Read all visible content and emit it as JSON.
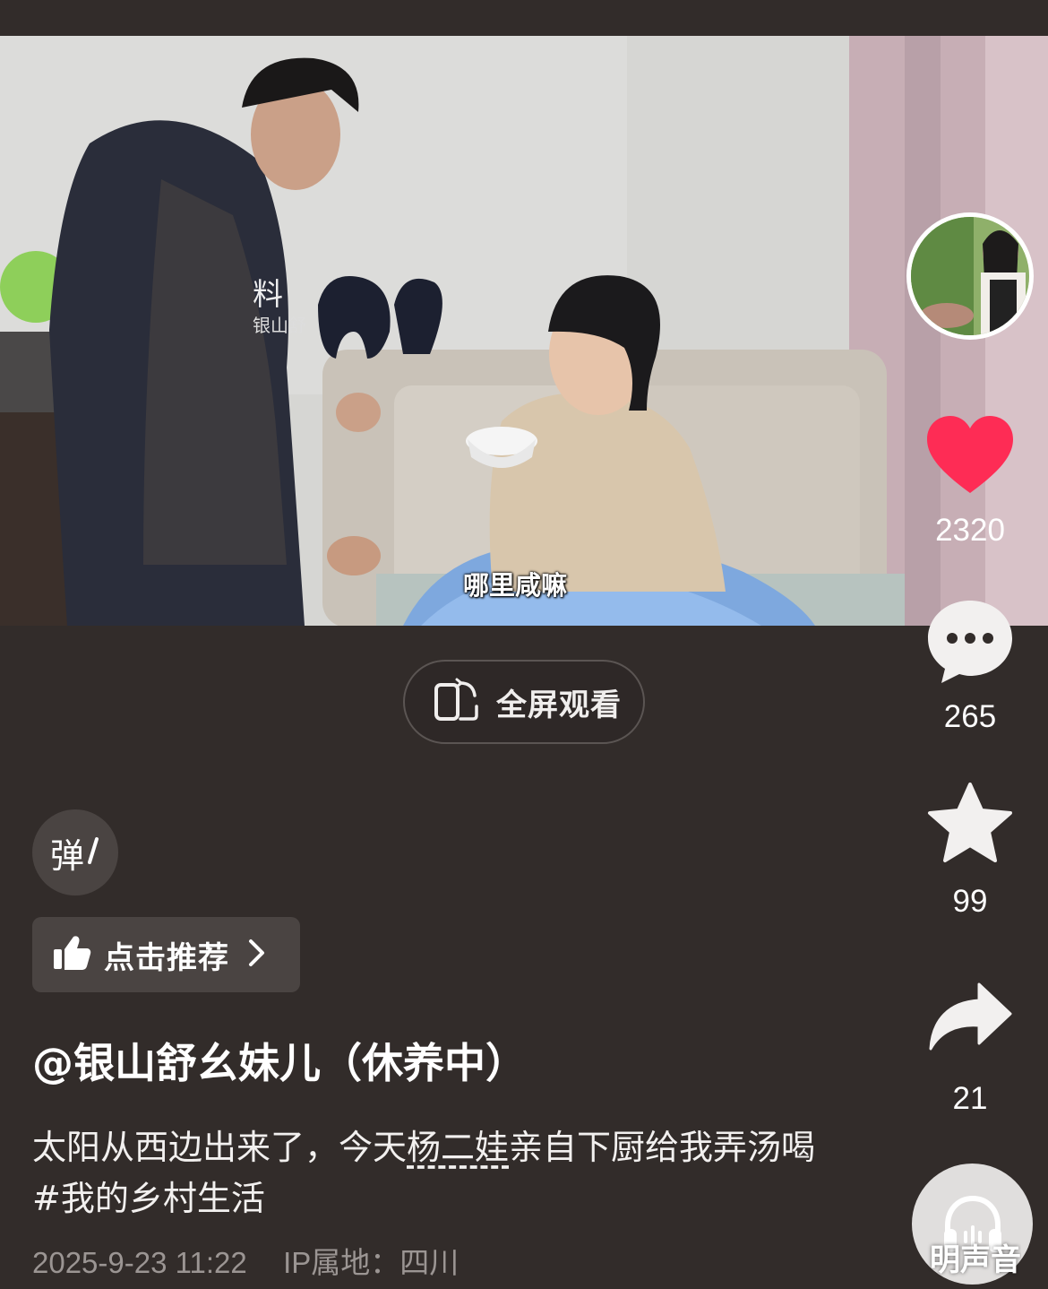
{
  "video": {
    "subtitle": "哪里咸嘛",
    "apron_text_1": "料",
    "apron_text_2": "银山舒"
  },
  "fullscreen": {
    "label": "全屏观看",
    "icon": "rotate-fullscreen-icon"
  },
  "actions": {
    "like_count": "2320",
    "comment_count": "265",
    "favorite_count": "99",
    "share_count": "21",
    "like_color": "#fe2c55"
  },
  "danmaku": {
    "label": "弹"
  },
  "recommend": {
    "label": "点击推荐"
  },
  "post": {
    "author": "@银山舒幺妹儿（休养中）",
    "desc_part1": "太阳从西边出来了，今天",
    "desc_mention": "杨二娃",
    "desc_part2": "亲自下厨给我弄汤喝",
    "desc_hashtag": "#我的乡村生活",
    "datetime": "2025-9-23 11:22",
    "ip_location": "IP属地：四川"
  },
  "music": {
    "label": "明声音"
  }
}
